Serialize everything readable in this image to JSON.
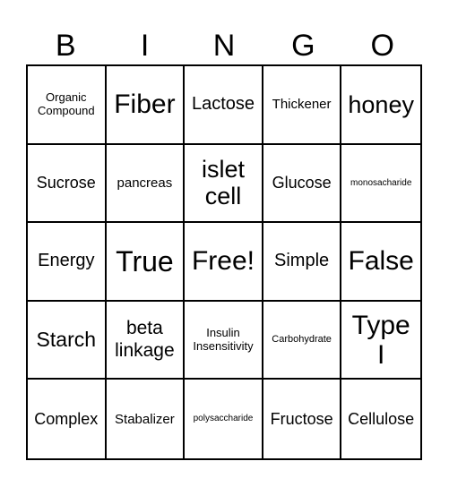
{
  "header": [
    "B",
    "I",
    "N",
    "G",
    "O"
  ],
  "cells": [
    "Organic Compound",
    "Fiber",
    "Lactose",
    "Thickener",
    "honey",
    "Sucrose",
    "pancreas",
    "islet cell",
    "Glucose",
    "monosacharide",
    "Energy",
    "True",
    "Free!",
    "Simple",
    "False",
    "Starch",
    "beta linkage",
    "Insulin Insensitivity",
    "Carbohydrate",
    "Type I",
    "Complex",
    "Stabalizer",
    "polysaccharide",
    "Fructose",
    "Cellulose"
  ]
}
